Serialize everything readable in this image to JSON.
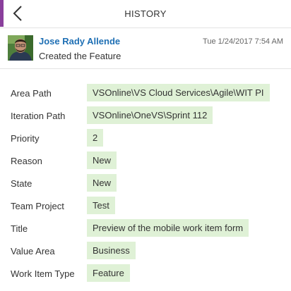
{
  "header": {
    "title": "HISTORY",
    "back_icon": "chevron-left-icon"
  },
  "entry": {
    "author": "Jose Rady Allende",
    "timestamp": "Tue 1/24/2017 7:54 AM",
    "action": "Created the Feature"
  },
  "fields": [
    {
      "label": "Area Path",
      "value": "VSOnline\\VS Cloud Services\\Agile\\WIT PI"
    },
    {
      "label": "Iteration Path",
      "value": "VSOnline\\OneVS\\Sprint 112"
    },
    {
      "label": "Priority",
      "value": "2"
    },
    {
      "label": "Reason",
      "value": "New"
    },
    {
      "label": "State",
      "value": "New"
    },
    {
      "label": "Team Project",
      "value": "Test"
    },
    {
      "label": "Title",
      "value": "Preview of the mobile work item form"
    },
    {
      "label": "Value Area",
      "value": "Business"
    },
    {
      "label": "Work Item Type",
      "value": "Feature"
    }
  ],
  "colors": {
    "accent": "#8a3f9c",
    "link": "#1e6fb4",
    "changed_value_bg": "#dff1d6"
  }
}
